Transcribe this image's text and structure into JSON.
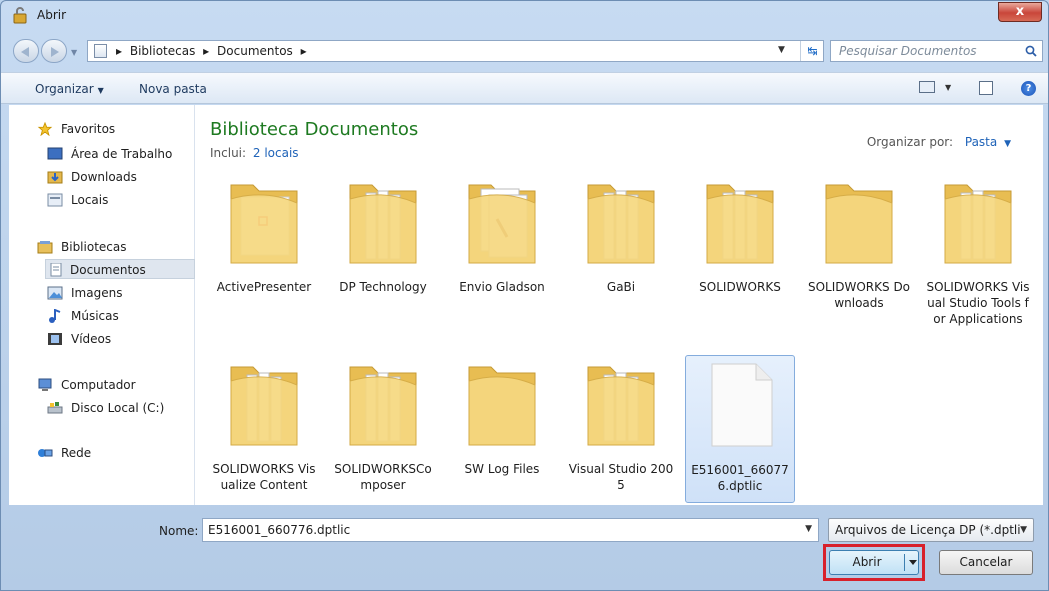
{
  "window": {
    "title": "Abrir",
    "close_glyph": "x"
  },
  "address": {
    "crumbs": [
      "Bibliotecas",
      "Documentos"
    ],
    "separator": "▸",
    "search_placeholder": "Pesquisar Documentos"
  },
  "toolbar": {
    "organize_label": "Organizar",
    "new_folder_label": "Nova pasta",
    "help_glyph": "?"
  },
  "sidebar": {
    "items": [
      {
        "label": "Favoritos",
        "icon": "star-icon"
      },
      {
        "label": "Área de Trabalho",
        "icon": "desktop-icon"
      },
      {
        "label": "Downloads",
        "icon": "downloads-icon"
      },
      {
        "label": "Locais",
        "icon": "recent-places-icon"
      },
      {
        "label": "Bibliotecas",
        "icon": "libraries-icon"
      },
      {
        "label": "Documentos",
        "icon": "documents-icon",
        "selected": true
      },
      {
        "label": "Imagens",
        "icon": "pictures-icon"
      },
      {
        "label": "Músicas",
        "icon": "music-icon"
      },
      {
        "label": "Vídeos",
        "icon": "videos-icon"
      },
      {
        "label": "Computador",
        "icon": "computer-icon"
      },
      {
        "label": "Disco Local (C:)",
        "icon": "local-disk-icon"
      },
      {
        "label": "Rede",
        "icon": "network-icon"
      }
    ]
  },
  "main": {
    "title": "Biblioteca Documentos",
    "includes_label": "Inclui:",
    "includes_link": "2 locais",
    "arrange_label": "Organizar por:",
    "arrange_value": "Pasta"
  },
  "files": [
    {
      "label": "ActivePresenter",
      "kind": "folder-doc"
    },
    {
      "label": "DP Technology",
      "kind": "folder"
    },
    {
      "label": "Envio Gladson",
      "kind": "folder-pages"
    },
    {
      "label": "GaBi",
      "kind": "folder"
    },
    {
      "label": "SOLIDWORKS",
      "kind": "folder"
    },
    {
      "label": "SOLIDWORKS Downloads",
      "kind": "folder-empty"
    },
    {
      "label": "SOLIDWORKS Visual Studio Tools for Applications",
      "kind": "folder"
    },
    {
      "label": "SOLIDWORKS Visualize Content",
      "kind": "folder"
    },
    {
      "label": "SOLIDWORKSComposer",
      "kind": "folder"
    },
    {
      "label": "SW Log Files",
      "kind": "folder-empty"
    },
    {
      "label": "Visual Studio 2005",
      "kind": "folder"
    },
    {
      "label": "E516001_660776.dptlic",
      "kind": "file",
      "selected": true
    }
  ],
  "bottom": {
    "name_label": "Nome:",
    "name_value": "E516001_660776.dptlic",
    "filetype_value": "Arquivos de Licença DP (*.dptli",
    "open_label": "Abrir",
    "cancel_label": "Cancelar"
  },
  "colors": {
    "title_green": "#1e7a21",
    "link_blue": "#1f63b8",
    "highlight_red": "#d8202b",
    "folder_yellow": "#f3d27b"
  }
}
